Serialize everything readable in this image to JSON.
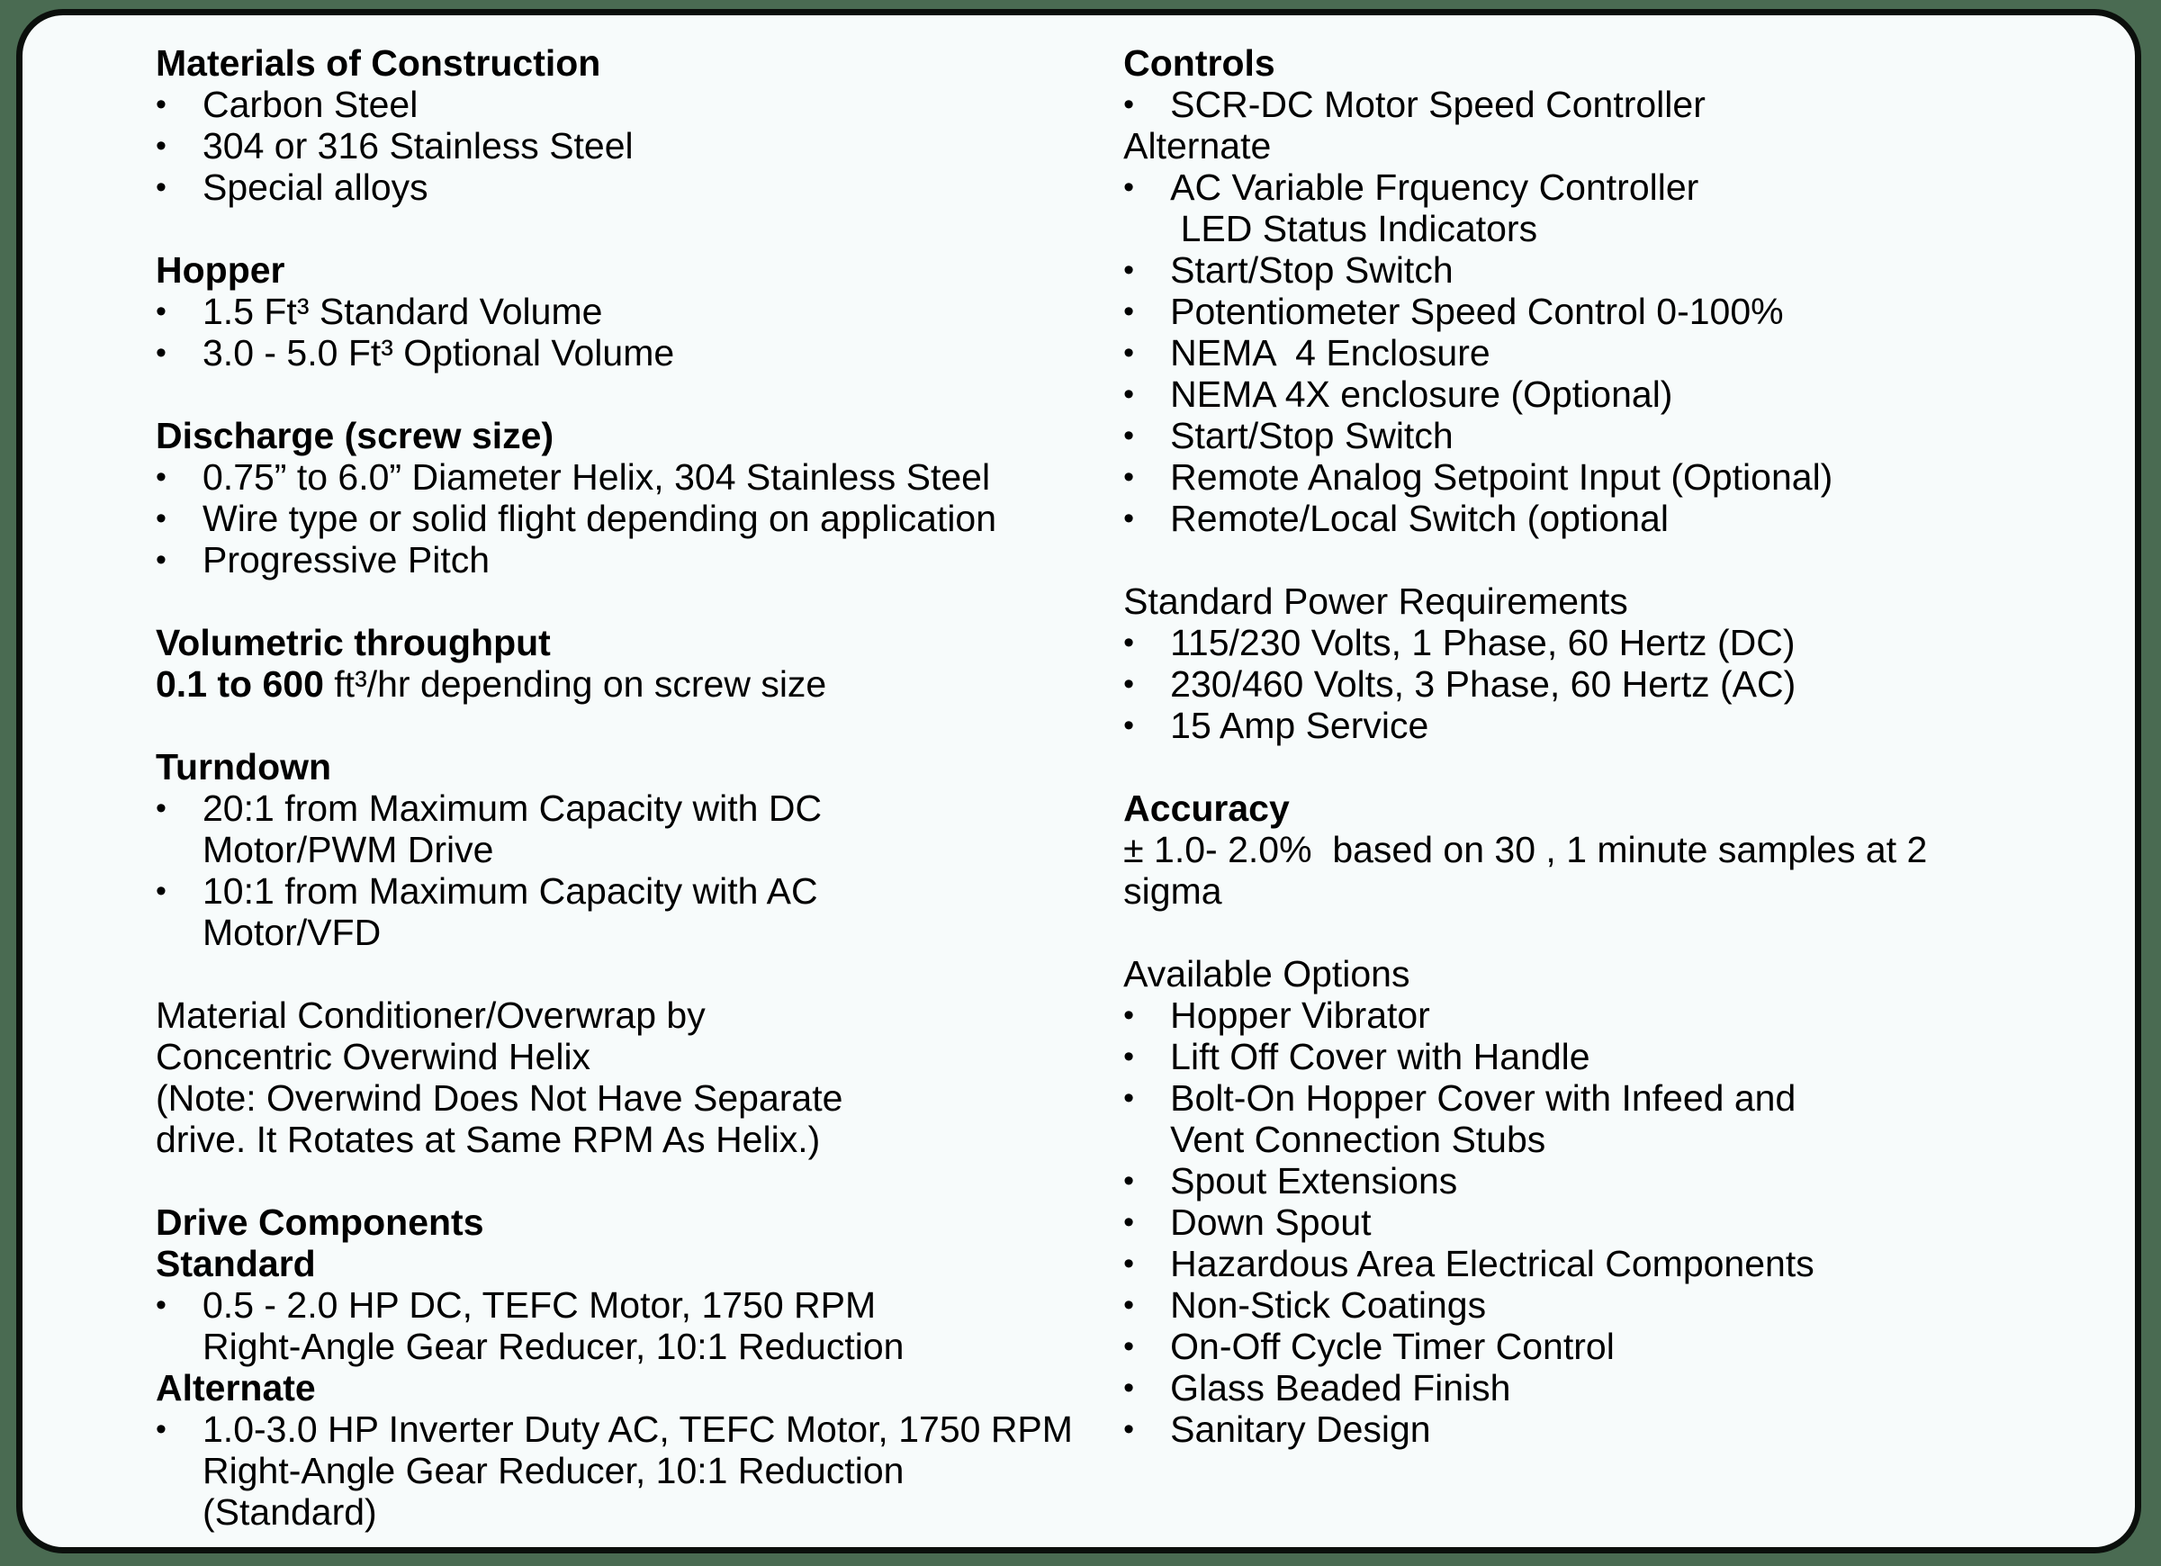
{
  "slide": {
    "border_color": "#0b0f0c",
    "page_background": "#4a6b52",
    "content_background": "#f7fbfb",
    "bullet_glyph": "•"
  },
  "left_column": {
    "materials": {
      "heading": "Materials of Construction",
      "items": [
        "Carbon Steel",
        "304 or 316 Stainless Steel",
        "Special alloys"
      ]
    },
    "hopper": {
      "heading": "Hopper",
      "items": [
        "1.5 Ft³ Standard Volume",
        "3.0 - 5.0 Ft³ Optional Volume"
      ]
    },
    "discharge": {
      "heading": "Discharge (screw size)",
      "items": [
        "0.75” to 6.0” Diameter Helix, 304 Stainless Steel",
        "Wire type or solid flight depending on application",
        "Progressive Pitch"
      ]
    },
    "volumetric": {
      "heading": "Volumetric throughput",
      "value_bold": "0.1 to 600",
      "value_rest": " ft³/hr depending on screw size"
    },
    "turndown": {
      "heading": "Turndown",
      "items": [
        {
          "line1": "20:1 from Maximum Capacity with DC",
          "line2": "Motor/PWM Drive"
        },
        {
          "line1": "10:1 from Maximum Capacity with AC",
          "line2": "Motor/VFD"
        }
      ]
    },
    "conditioner": {
      "lines": [
        "Material Conditioner/Overwrap by",
        "Concentric Overwind Helix",
        "(Note: Overwind Does Not Have Separate",
        "drive. It Rotates at Same RPM As Helix.)"
      ]
    },
    "drive_components": {
      "heading": "Drive Components",
      "standard_label": "Standard",
      "standard_item": {
        "line1": "0.5 - 2.0 HP DC, TEFC Motor, 1750 RPM",
        "line2": "Right-Angle Gear Reducer, 10:1 Reduction"
      },
      "alternate_label": "Alternate",
      "alternate_item": {
        "line1": "1.0-3.0 HP Inverter Duty AC, TEFC Motor, 1750 RPM",
        "line2": "Right-Angle Gear Reducer, 10:1 Reduction",
        "line3": "(Standard)"
      }
    }
  },
  "right_column": {
    "controls": {
      "heading": "Controls",
      "first_item": "SCR-DC Motor Speed Controller",
      "alternate_label": "Alternate",
      "alternate_item": {
        "line1": "AC Variable Frquency Controller",
        "line2": " LED Status Indicators"
      },
      "items": [
        "Start/Stop Switch",
        "Potentiometer Speed Control 0-100%",
        "NEMA  4 Enclosure",
        "NEMA 4X enclosure (Optional)",
        "Start/Stop Switch",
        "Remote Analog Setpoint Input (Optional)",
        "Remote/Local Switch (optional"
      ]
    },
    "power": {
      "heading": "Standard Power Requirements",
      "items": [
        "115/230 Volts, 1 Phase, 60 Hertz (DC)",
        "230/460 Volts, 3 Phase, 60 Hertz (AC)",
        "15 Amp Service"
      ]
    },
    "accuracy": {
      "heading": "Accuracy",
      "line1": "± 1.0- 2.0%  based on 30 , 1 minute samples at 2",
      "line2": "sigma"
    },
    "options": {
      "heading": "Available Options",
      "items": [
        {
          "line1": "Hopper Vibrator"
        },
        {
          "line1": "Lift Off Cover with Handle"
        },
        {
          "line1": "Bolt-On Hopper Cover with Infeed and",
          "line2": "Vent Connection Stubs"
        },
        {
          "line1": "Spout Extensions"
        },
        {
          "line1": "Down Spout"
        },
        {
          "line1": "Hazardous Area Electrical Components"
        },
        {
          "line1": "Non-Stick Coatings"
        },
        {
          "line1": "On-Off Cycle Timer Control"
        },
        {
          "line1": "Glass Beaded Finish"
        },
        {
          "line1": "Sanitary Design"
        }
      ]
    }
  }
}
